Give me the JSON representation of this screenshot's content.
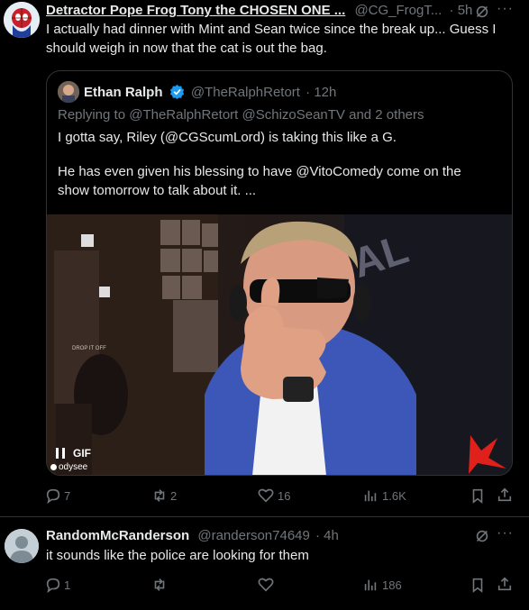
{
  "tweet1": {
    "display_name": "Detractor Pope Frog Tony the CHOSEN ONE ...",
    "handle": "@CG_FrogT...",
    "time": "· 5h",
    "text_line1": "I actually had dinner with Mint and Sean twice since the break up... Guess I",
    "text_line2": "should weigh in now that the cat is out the bag.",
    "quote": {
      "display_name": "Ethan Ralph",
      "handle": "@TheRalphRetort",
      "time": "· 12h",
      "replying_to": "Replying to @TheRalphRetort @SchizoSeanTV and 2 others",
      "text_line1": "I gotta say, Riley (@CGScumLord) is taking this like a G.",
      "text_line2": "He has even given his blessing to have @VitoComedy come on the",
      "text_line3": "show tomorrow to talk about it. ...",
      "gif_label": "GIF",
      "odysee_label": "odysee",
      "sign_text": "DROP IT OFF"
    },
    "actions": {
      "replies": "7",
      "retweets": "2",
      "likes": "16",
      "views": "1.6K"
    }
  },
  "tweet2": {
    "display_name": "RandomMcRanderson",
    "handle": "@randerson74649",
    "time": "· 4h",
    "text": "it sounds like the police are looking for them",
    "actions": {
      "replies": "1",
      "retweets": "",
      "likes": "",
      "views": "186"
    }
  },
  "colors": {
    "verified": "#1d9bf0",
    "divider": "#2f3336",
    "muted": "#71767b"
  }
}
